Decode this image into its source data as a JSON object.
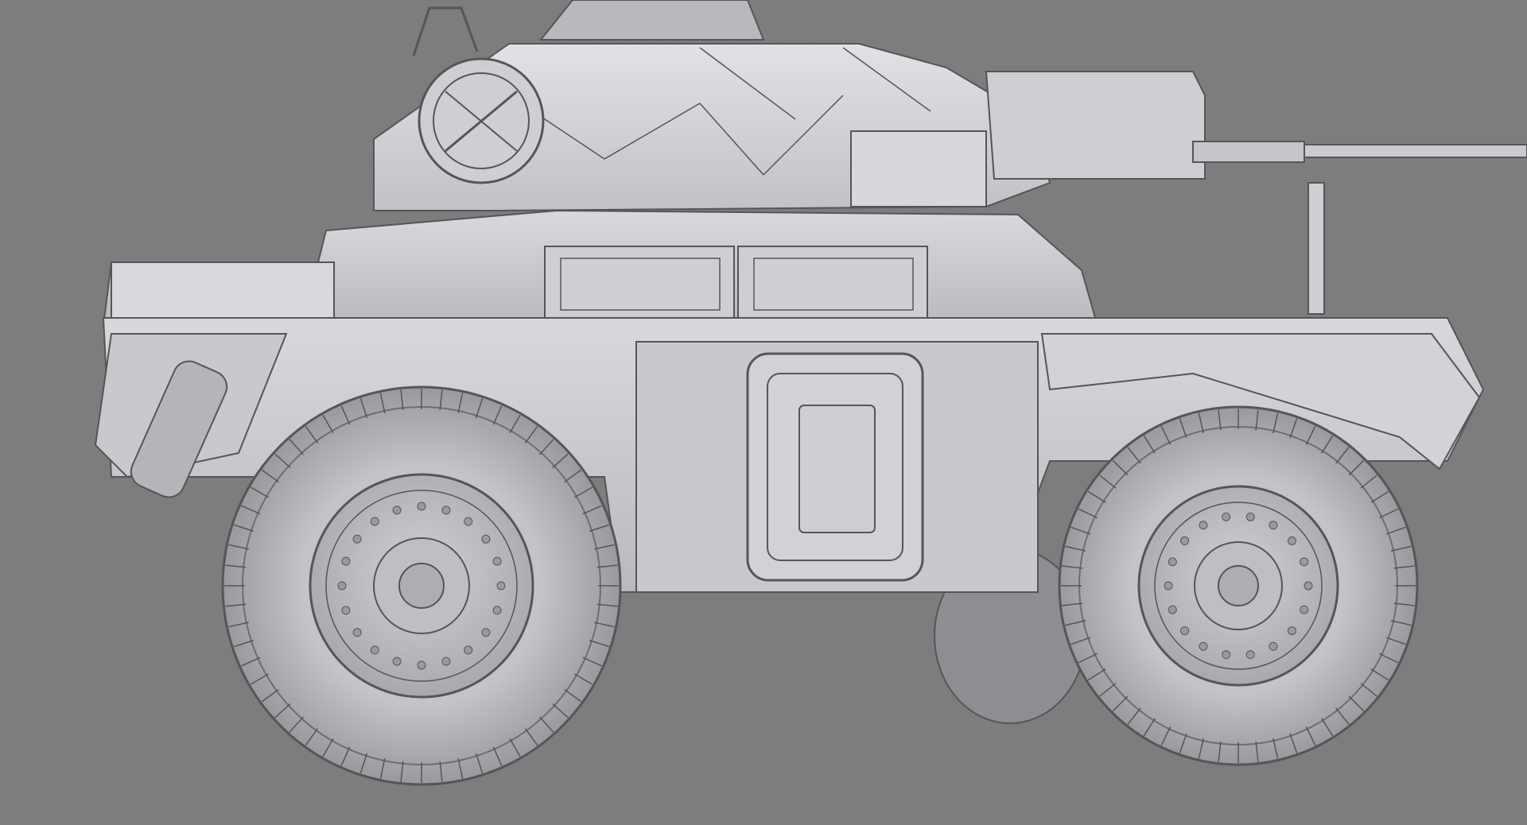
{
  "scene": {
    "subject": "armored-car-wireframe-render",
    "view": "side",
    "colors": {
      "background": "#7d7d7d",
      "body": "#c9c8cc",
      "body_light": "#dcdbdf",
      "body_dark": "#9f9ea3",
      "line": "#55555a",
      "tire": "#b8b7bb",
      "tire_dark": "#7a797e"
    }
  }
}
